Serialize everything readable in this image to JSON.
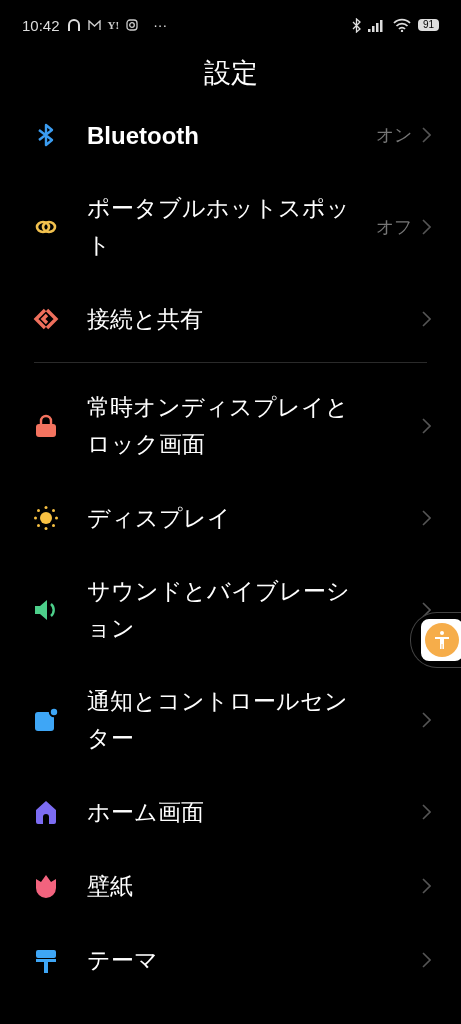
{
  "status_bar": {
    "time": "10:42",
    "yahoo": "Y!",
    "more": "···",
    "battery": "91"
  },
  "title": "設定",
  "sections": [
    {
      "items": [
        {
          "kind": "bluetooth",
          "color": "#3b9cf0",
          "label": "Bluetooth",
          "value": "オン",
          "bold": true
        },
        {
          "kind": "link",
          "color": "#f2c14e",
          "label": "ポータブルホットスポット",
          "value": "オフ",
          "bold": false
        },
        {
          "kind": "share",
          "color": "#ee6f5c",
          "label": "接続と共有",
          "bold": false
        }
      ]
    },
    {
      "items": [
        {
          "kind": "lock",
          "color": "#f4735f",
          "label": "常時オンディスプレイとロック画面",
          "bold": false
        },
        {
          "kind": "sun",
          "color": "#f7c042",
          "label": "ディスプレイ",
          "bold": false
        },
        {
          "kind": "sound",
          "color": "#4ccf8a",
          "label": "サウンドとバイブレーション",
          "bold": false
        },
        {
          "kind": "notify",
          "color": "#3ea6f6",
          "label": "通知とコントロールセンター",
          "bold": false
        },
        {
          "kind": "home",
          "color": "#7c6cf2",
          "label": "ホーム画面",
          "bold": false
        },
        {
          "kind": "tulip",
          "color": "#f2637e",
          "label": "壁紙",
          "bold": false
        },
        {
          "kind": "brush",
          "color": "#3ea6f6",
          "label": "テーマ",
          "bold": false
        }
      ]
    }
  ]
}
